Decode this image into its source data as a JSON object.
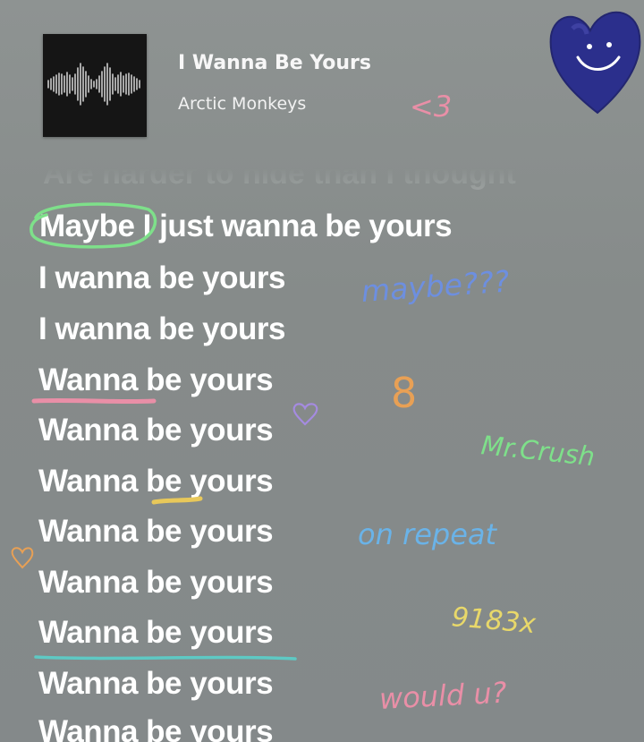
{
  "now_playing": {
    "title": "I Wanna Be Yours",
    "artist": "Arctic Monkeys",
    "album_art_icon": "sound-wave-icon"
  },
  "lyrics": {
    "faded_previous_line": "Are harder to hide than I thought",
    "current_line": "Maybe I just wanna be yours",
    "lines": [
      "I wanna be yours",
      "I wanna be yours",
      "Wanna be yours",
      "Wanna be yours",
      "Wanna be yours",
      "Wanna be yours",
      "Wanna be yours",
      "Wanna be yours",
      "Wanna be yours",
      "Wanna be yours"
    ]
  },
  "annotations": {
    "heart_note": "<3",
    "maybe_note": "maybe???",
    "eight_note": "8",
    "crush_note": "Mr.Crush",
    "repeat_note": "on repeat",
    "count_note": "9183x",
    "question_note": "would u?"
  },
  "colors": {
    "background": "#868b8a",
    "lyric_text": "#ffffff",
    "heart_sticker": "#2b2f8c",
    "green_marker": "#7ee08a",
    "pink_marker": "#e98fa7",
    "yellow_marker": "#e8c85a",
    "teal_marker": "#5ec9c4",
    "blue_marker": "#6d8fe0",
    "orange_marker": "#e8a055",
    "purple_marker": "#a58be0"
  }
}
